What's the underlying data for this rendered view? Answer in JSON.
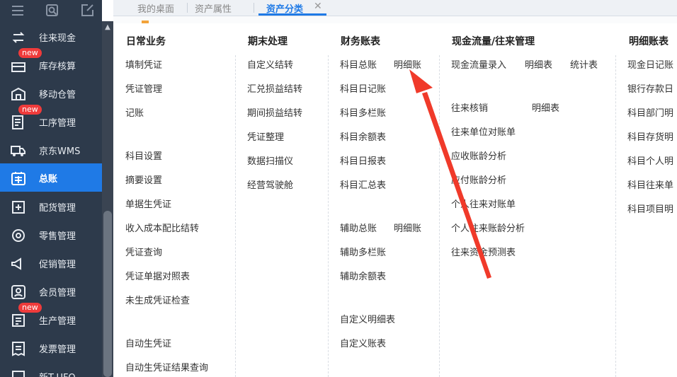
{
  "sidebar": {
    "top_icons": [
      "menu-icon",
      "search-icon",
      "edit-icon"
    ],
    "items": [
      {
        "label": "往来现金",
        "icon": "cash-flow-icon",
        "new": false
      },
      {
        "label": "库存核算",
        "icon": "inventory-icon",
        "new": true
      },
      {
        "label": "移动仓管",
        "icon": "warehouse-icon",
        "new": false
      },
      {
        "label": "工序管理",
        "icon": "process-icon",
        "new": true
      },
      {
        "label": "京东WMS",
        "icon": "truck-icon",
        "new": false
      },
      {
        "label": "总账",
        "icon": "ledger-icon",
        "new": false,
        "active": true
      },
      {
        "label": "配货管理",
        "icon": "distribution-icon",
        "new": false
      },
      {
        "label": "零售管理",
        "icon": "retail-icon",
        "new": false
      },
      {
        "label": "促销管理",
        "icon": "megaphone-icon",
        "new": false
      },
      {
        "label": "会员管理",
        "icon": "member-icon",
        "new": false
      },
      {
        "label": "生产管理",
        "icon": "production-icon",
        "new": true
      },
      {
        "label": "发票管理",
        "icon": "invoice-icon",
        "new": false
      },
      {
        "label": "新T-UFO",
        "icon": "report-icon",
        "new": false
      }
    ],
    "new_badge": "new"
  },
  "tabs": [
    "我的桌面",
    "资产属性",
    "资产分类"
  ],
  "menu": {
    "col1": {
      "header": "日常业务",
      "items": [
        "填制凭证",
        "凭证管理",
        "记账",
        "科目设置",
        "摘要设置",
        "单据生凭证",
        "收入成本配比结转",
        "凭证查询",
        "凭证单据对照表",
        "未生成凭证检查",
        "自动生凭证",
        "自动生凭证结果查询"
      ]
    },
    "col2": {
      "header": "期末处理",
      "items": [
        "自定义结转",
        "汇兑损益结转",
        "期间损益结转",
        "凭证整理",
        "数据扫描仪",
        "经营驾驶舱"
      ]
    },
    "col3": {
      "header": "财务账表",
      "items": [
        "科目总账",
        "明细账",
        "科目日记账",
        "科目多栏账",
        "科目余额表",
        "科目日报表",
        "科目汇总表",
        "辅助总账",
        "明细账",
        "辅助多栏账",
        "辅助余额表",
        "自定义明细表",
        "自定义账表"
      ]
    },
    "col4": {
      "header": "现金流量/往来管理",
      "items": [
        "现金流量录入",
        "明细表",
        "统计表",
        "往来核销",
        "明细表",
        "往来单位对账单",
        "应收账龄分析",
        "应付账龄分析",
        "个人往来对账单",
        "个人往来账龄分析",
        "往来资金预测表"
      ]
    },
    "col5": {
      "header": "明细账表",
      "items": [
        "现金日记账",
        "银行存款日",
        "科目部门明",
        "科目存货明",
        "科目个人明",
        "科目往来单",
        "科目项目明"
      ]
    }
  },
  "colors": {
    "sidebar": "#2d3a4b",
    "active": "#1f7ae6",
    "badge": "#ef3b3b",
    "arrow": "#f03a2a"
  }
}
